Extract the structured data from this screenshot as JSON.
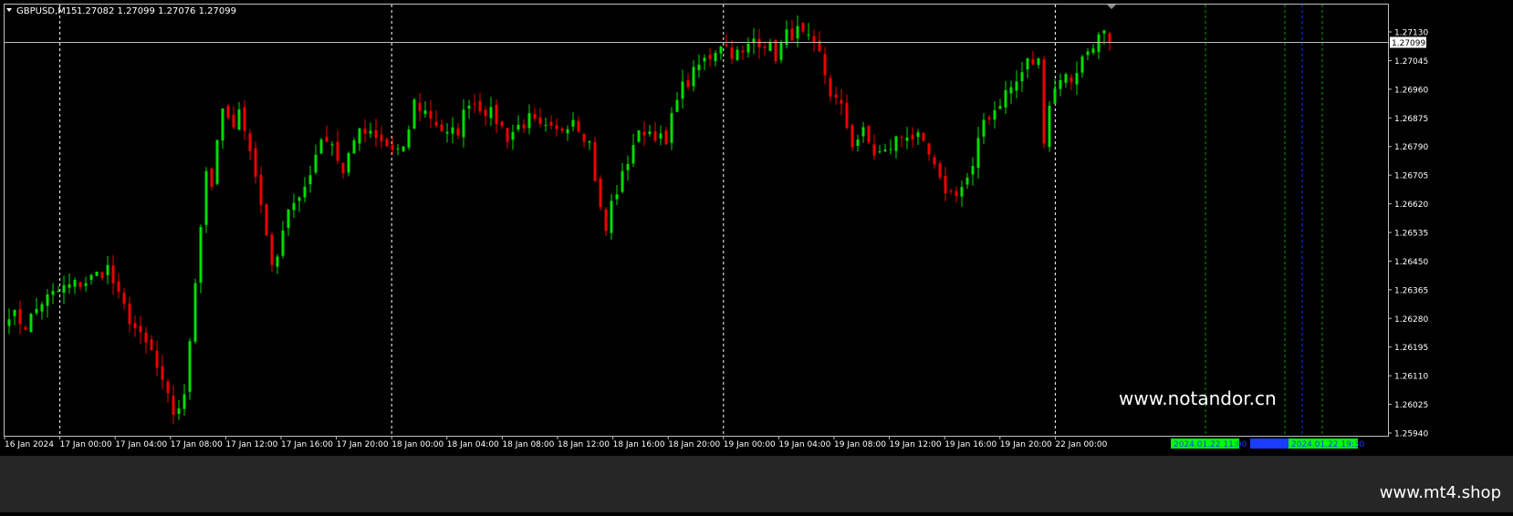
{
  "window": {
    "symbol_label": "GBPUSD,M15",
    "ohlc_label": "1.27082 1.27099 1.27076 1.27099"
  },
  "price_label": "1.27099",
  "watermark": "www.notandor.cn",
  "footer_text": "www.mt4.shop",
  "colors": {
    "background": "#000000",
    "bull_candle": "#00dd00",
    "bear_candle": "#ee0000",
    "grid_dash": "#ffffff",
    "axis_text": "#ffffff",
    "footer_bg": "#262626",
    "green_box": "#00ff00",
    "blue_box": "#1a3cff",
    "green_vline": "#00a000",
    "blue_vline": "#1030ff"
  },
  "time_boxes": [
    {
      "label": "2024.01.22 11:00",
      "color": "#00ff00"
    },
    {
      "label": "",
      "color": "#1a3cff"
    },
    {
      "label": "2024.01.22 19:30",
      "color": "#00ff00"
    }
  ],
  "chart_data": {
    "type": "candlestick",
    "symbol": "GBPUSD",
    "timeframe": "M15",
    "ylim": [
      1.2594,
      1.2718
    ],
    "yticks": [
      "1.27130",
      "1.27045",
      "1.26960",
      "1.26875",
      "1.26790",
      "1.26705",
      "1.26620",
      "1.26535",
      "1.26450",
      "1.26365",
      "1.26280",
      "1.26195",
      "1.26110",
      "1.26025",
      "1.25940"
    ],
    "current_price": 1.27099,
    "xticks": [
      "16 Jan 2024",
      "17 Jan 00:00",
      "17 Jan 04:00",
      "17 Jan 08:00",
      "17 Jan 12:00",
      "17 Jan 16:00",
      "17 Jan 20:00",
      "18 Jan 00:00",
      "18 Jan 04:00",
      "18 Jan 08:00",
      "18 Jan 12:00",
      "18 Jan 16:00",
      "18 Jan 20:00",
      "19 Jan 00:00",
      "19 Jan 04:00",
      "19 Jan 08:00",
      "19 Jan 12:00",
      "19 Jan 16:00",
      "19 Jan 20:00",
      "22 Jan 00:00"
    ],
    "day_separators": [
      "17 Jan 00:00",
      "18 Jan 00:00",
      "19 Jan 00:00",
      "22 Jan 00:00"
    ],
    "close_path": [
      [
        0,
        1.263
      ],
      [
        3,
        1.2626
      ],
      [
        6,
        1.2633
      ],
      [
        10,
        1.2637
      ],
      [
        14,
        1.2639
      ],
      [
        18,
        1.2643
      ],
      [
        20,
        1.2634
      ],
      [
        22,
        1.2628
      ],
      [
        24,
        1.2622
      ],
      [
        26,
        1.2618
      ],
      [
        28,
        1.2608
      ],
      [
        30,
        1.26
      ],
      [
        32,
        1.2604
      ],
      [
        34,
        1.264
      ],
      [
        36,
        1.2672
      ],
      [
        37,
        1.2668
      ],
      [
        39,
        1.269
      ],
      [
        41,
        1.2683
      ],
      [
        42,
        1.2692
      ],
      [
        45,
        1.267
      ],
      [
        47,
        1.2654
      ],
      [
        48,
        1.2642
      ],
      [
        51,
        1.2661
      ],
      [
        53,
        1.2662
      ],
      [
        55,
        1.2672
      ],
      [
        57,
        1.2682
      ],
      [
        59,
        1.268
      ],
      [
        61,
        1.2671
      ],
      [
        63,
        1.2682
      ],
      [
        65,
        1.2683
      ],
      [
        67,
        1.2681
      ],
      [
        70,
        1.2678
      ],
      [
        72,
        1.2677
      ],
      [
        74,
        1.2692
      ],
      [
        77,
        1.2688
      ],
      [
        80,
        1.2682
      ],
      [
        82,
        1.2684
      ],
      [
        84,
        1.2693
      ],
      [
        87,
        1.269
      ],
      [
        89,
        1.2687
      ],
      [
        91,
        1.2682
      ],
      [
        93,
        1.2685
      ],
      [
        95,
        1.2687
      ],
      [
        97,
        1.2684
      ],
      [
        100,
        1.2683
      ],
      [
        103,
        1.2688
      ],
      [
        106,
        1.268
      ],
      [
        108,
        1.266
      ],
      [
        109,
        1.2654
      ],
      [
        110,
        1.2662
      ],
      [
        112,
        1.267
      ],
      [
        114,
        1.268
      ],
      [
        116,
        1.2684
      ],
      [
        118,
        1.2683
      ],
      [
        120,
        1.2679
      ],
      [
        122,
        1.2695
      ],
      [
        124,
        1.2698
      ],
      [
        126,
        1.2703
      ],
      [
        128,
        1.2706
      ],
      [
        130,
        1.271
      ],
      [
        132,
        1.2707
      ],
      [
        134,
        1.2706
      ],
      [
        136,
        1.2711
      ],
      [
        138,
        1.271
      ],
      [
        140,
        1.2706
      ],
      [
        142,
        1.2712
      ],
      [
        144,
        1.2713
      ],
      [
        146,
        1.271
      ],
      [
        148,
        1.2706
      ],
      [
        150,
        1.2695
      ],
      [
        152,
        1.269
      ],
      [
        154,
        1.268
      ],
      [
        156,
        1.2683
      ],
      [
        158,
        1.2677
      ],
      [
        160,
        1.2677
      ],
      [
        162,
        1.2681
      ],
      [
        164,
        1.2683
      ],
      [
        166,
        1.2681
      ],
      [
        168,
        1.2676
      ],
      [
        170,
        1.2668
      ],
      [
        172,
        1.2665
      ],
      [
        174,
        1.2667
      ],
      [
        176,
        1.2672
      ],
      [
        178,
        1.2687
      ],
      [
        180,
        1.269
      ],
      [
        182,
        1.2695
      ],
      [
        184,
        1.2698
      ],
      [
        186,
        1.2704
      ],
      [
        188,
        1.2704
      ],
      [
        189,
        1.2682
      ],
      [
        190,
        1.2692
      ],
      [
        192,
        1.27
      ],
      [
        194,
        1.2699
      ],
      [
        196,
        1.2705
      ],
      [
        198,
        1.271
      ],
      [
        200,
        1.2712
      ],
      [
        201,
        1.271
      ]
    ]
  }
}
